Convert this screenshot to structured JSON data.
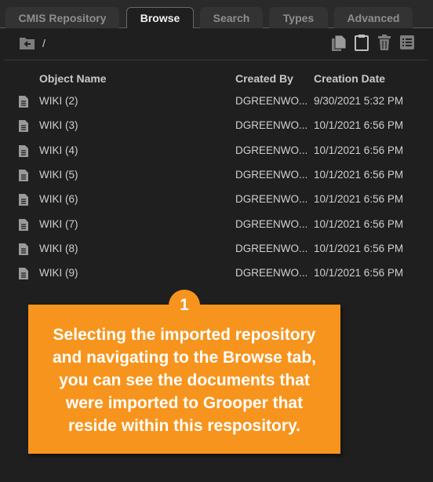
{
  "tabs": [
    {
      "label": "CMIS Repository",
      "active": false
    },
    {
      "label": "Browse",
      "active": true
    },
    {
      "label": "Search",
      "active": false
    },
    {
      "label": "Types",
      "active": false
    },
    {
      "label": "Advanced",
      "active": false
    }
  ],
  "toolbar": {
    "path": "/",
    "icons": [
      "folder-up-icon",
      "copy-icon",
      "clipboard-icon",
      "trash-icon",
      "list-icon"
    ]
  },
  "table": {
    "columns": [
      "Object Name",
      "Created By",
      "Creation Date"
    ],
    "rows": [
      {
        "name": "WIKI (2)",
        "created_by": "DGREENWO...",
        "date": "9/30/2021 5:32 PM"
      },
      {
        "name": "WIKI (3)",
        "created_by": "DGREENWO...",
        "date": "10/1/2021 6:56 PM"
      },
      {
        "name": "WIKI (4)",
        "created_by": "DGREENWO...",
        "date": "10/1/2021 6:56 PM"
      },
      {
        "name": "WIKI (5)",
        "created_by": "DGREENWO...",
        "date": "10/1/2021 6:56 PM"
      },
      {
        "name": "WIKI (6)",
        "created_by": "DGREENWO...",
        "date": "10/1/2021 6:56 PM"
      },
      {
        "name": "WIKI (7)",
        "created_by": "DGREENWO...",
        "date": "10/1/2021 6:56 PM"
      },
      {
        "name": "WIKI (8)",
        "created_by": "DGREENWO...",
        "date": "10/1/2021 6:56 PM"
      },
      {
        "name": "WIKI (9)",
        "created_by": "DGREENWO...",
        "date": "10/1/2021 6:56 PM"
      }
    ]
  },
  "callout": {
    "number": "1",
    "text": "Selecting the imported repository and navigating to the Browse tab, you can see the documents that were imported to Grooper that reside within this respository."
  },
  "colors": {
    "accent": "#f7941d",
    "background": "#1f1f1f",
    "tab_bg": "#333333"
  }
}
